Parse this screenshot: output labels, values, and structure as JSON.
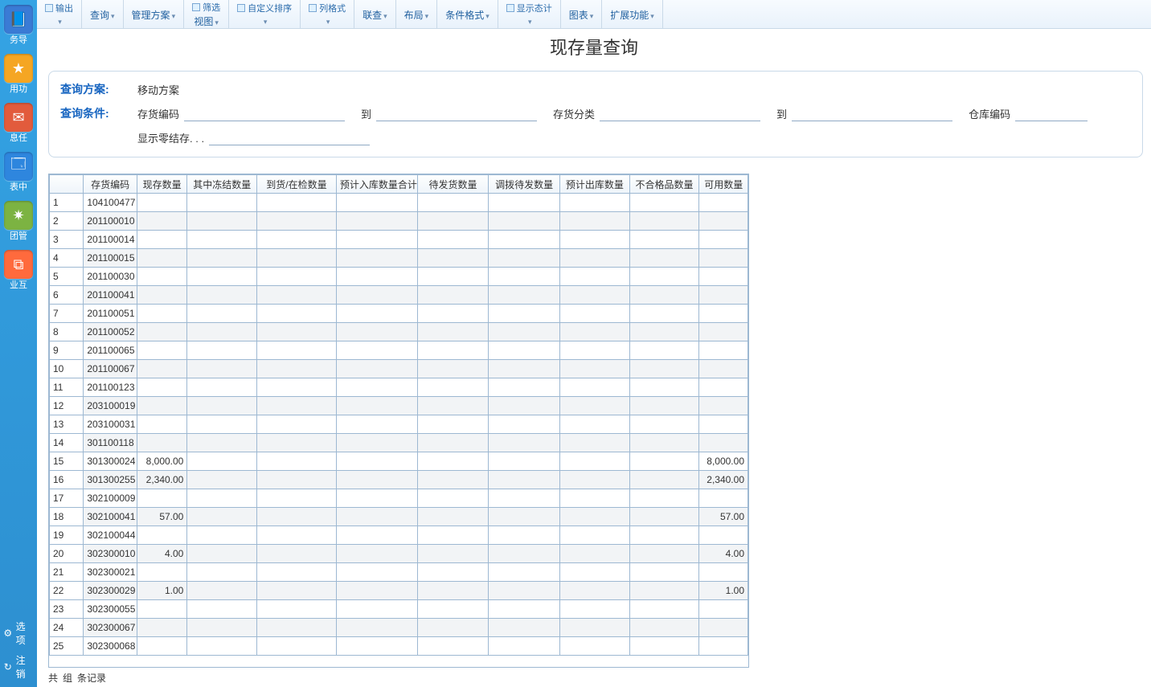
{
  "sidebar": {
    "items": [
      {
        "label": "务导",
        "icon": "📘",
        "bg": "#3a7bd5"
      },
      {
        "label": "用功",
        "icon": "★",
        "bg": "#f5a623"
      },
      {
        "label": "息任",
        "icon": "✉",
        "bg": "#e25b3c"
      },
      {
        "label": "表中",
        "icon": "🗔",
        "bg": "#2e86de"
      },
      {
        "label": "团管",
        "icon": "✷",
        "bg": "#7cb342"
      },
      {
        "label": "业互",
        "icon": "⧉",
        "bg": "#ff6a3d"
      }
    ],
    "bottom": [
      {
        "label": "选项",
        "glyph": "⚙"
      },
      {
        "label": "注销",
        "glyph": "↻"
      }
    ]
  },
  "ribbon": [
    {
      "top": "输出",
      "top_icon": "⎘",
      "bottom": "",
      "caret": true
    },
    {
      "top": "",
      "bottom": "查询",
      "caret": true
    },
    {
      "top": "",
      "bottom": "管理方案",
      "caret": true
    },
    {
      "top": "筛选",
      "top_icon": "▦",
      "bottom": "视图",
      "caret": true
    },
    {
      "top": "自定义排序",
      "top_icon": "⇅",
      "bottom": "",
      "caret": true
    },
    {
      "top": "列格式",
      "top_icon": "▥",
      "bottom": "",
      "caret": true
    },
    {
      "top": "",
      "bottom": "联查",
      "caret": true
    },
    {
      "top": "",
      "bottom": "布局",
      "caret": true
    },
    {
      "top": "",
      "bottom": "条件格式",
      "caret": true
    },
    {
      "top": "显示态计",
      "top_icon": "☑",
      "bottom": "",
      "caret": true
    },
    {
      "top": "",
      "bottom": "图表",
      "caret": true
    },
    {
      "top": "",
      "bottom": "扩展功能",
      "caret": true
    }
  ],
  "page_title": "现存量查询",
  "query": {
    "plan_label": "查询方案:",
    "plan_value": "移动方案",
    "cond_label": "查询条件:",
    "fields": {
      "stock_code": "存货编码",
      "to1": "到",
      "stock_cat": "存货分类",
      "to2": "到",
      "wh_code": "仓库编码",
      "show_zero": "显示零结存. . ."
    }
  },
  "grid": {
    "headers": [
      "存货编码",
      "现存数量",
      "其中冻结数量",
      "到货/在检数量",
      "预计入库数量合计",
      "待发货数量",
      "调拨待发数量",
      "预计出库数量",
      "不合格品数量",
      "可用数量"
    ],
    "rows": [
      {
        "n": 1,
        "code": "104100477",
        "qty": "",
        "avail": ""
      },
      {
        "n": 2,
        "code": "201100010",
        "qty": "",
        "avail": ""
      },
      {
        "n": 3,
        "code": "201100014",
        "qty": "",
        "avail": ""
      },
      {
        "n": 4,
        "code": "201100015",
        "qty": "",
        "avail": ""
      },
      {
        "n": 5,
        "code": "201100030",
        "qty": "",
        "avail": ""
      },
      {
        "n": 6,
        "code": "201100041",
        "qty": "",
        "avail": ""
      },
      {
        "n": 7,
        "code": "201100051",
        "qty": "",
        "avail": ""
      },
      {
        "n": 8,
        "code": "201100052",
        "qty": "",
        "avail": ""
      },
      {
        "n": 9,
        "code": "201100065",
        "qty": "",
        "avail": ""
      },
      {
        "n": 10,
        "code": "201100067",
        "qty": "",
        "avail": ""
      },
      {
        "n": 11,
        "code": "201100123",
        "qty": "",
        "avail": ""
      },
      {
        "n": 12,
        "code": "203100019",
        "qty": "",
        "avail": ""
      },
      {
        "n": 13,
        "code": "203100031",
        "qty": "",
        "avail": ""
      },
      {
        "n": 14,
        "code": "301100118",
        "qty": "",
        "avail": ""
      },
      {
        "n": 15,
        "code": "301300024",
        "qty": "8,000.00",
        "avail": "8,000.00"
      },
      {
        "n": 16,
        "code": "301300255",
        "qty": "2,340.00",
        "avail": "2,340.00"
      },
      {
        "n": 17,
        "code": "302100009",
        "qty": "",
        "avail": ""
      },
      {
        "n": 18,
        "code": "302100041",
        "qty": "57.00",
        "avail": "57.00"
      },
      {
        "n": 19,
        "code": "302100044",
        "qty": "",
        "avail": ""
      },
      {
        "n": 20,
        "code": "302300010",
        "qty": "4.00",
        "avail": "4.00"
      },
      {
        "n": 21,
        "code": "302300021",
        "qty": "",
        "avail": ""
      },
      {
        "n": 22,
        "code": "302300029",
        "qty": "1.00",
        "avail": "1.00"
      },
      {
        "n": 23,
        "code": "302300055",
        "qty": "",
        "avail": ""
      },
      {
        "n": 24,
        "code": "302300067",
        "qty": "",
        "avail": ""
      },
      {
        "n": 25,
        "code": "302300068",
        "qty": "",
        "avail": ""
      }
    ]
  },
  "footer": {
    "prefix": "共",
    "groups": "",
    "mid": "组",
    "records": "",
    "suffix": "条记录"
  }
}
